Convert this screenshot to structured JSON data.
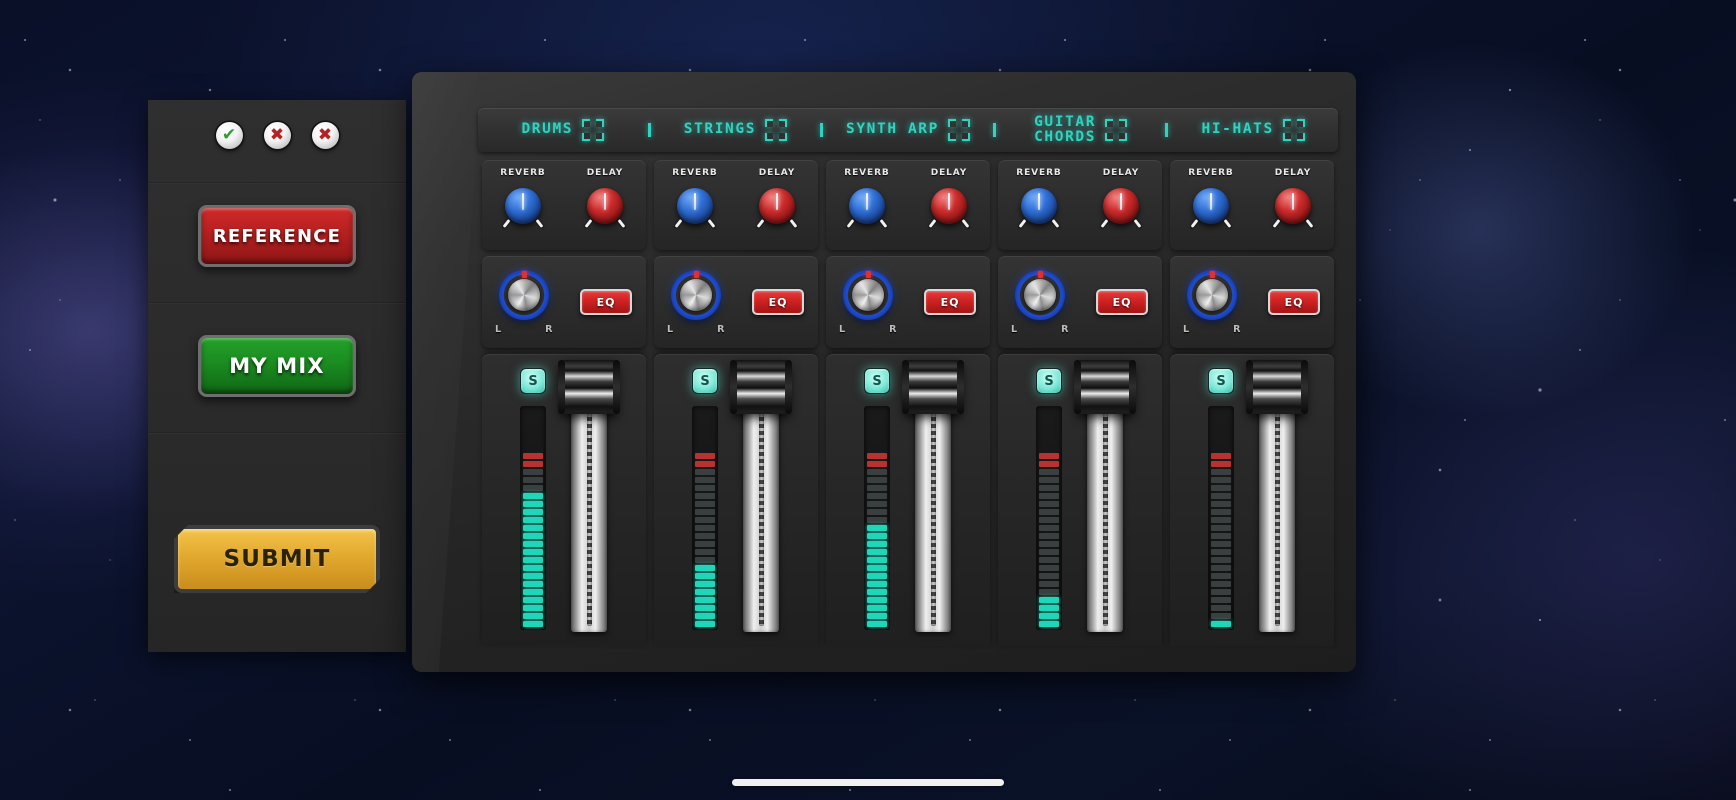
{
  "background": {
    "name": "starfield-nebula",
    "base_color": "#0a1228"
  },
  "left_panel": {
    "status_indicators": [
      {
        "name": "check-icon",
        "glyph": "✔",
        "state": "ok"
      },
      {
        "name": "cross-icon",
        "glyph": "✖",
        "state": "bad"
      },
      {
        "name": "cross-icon",
        "glyph": "✖",
        "state": "bad"
      }
    ],
    "reference_label": "REFERENCE",
    "mymix_label": "MY MIX",
    "submit_label": "SUBMIT",
    "colors": {
      "reference": "#b31f1f",
      "mymix": "#1a8a20",
      "submit": "#e2a92f"
    }
  },
  "console": {
    "accent_color": "#2fd4c0",
    "separator_glyph": "|",
    "tracks": [
      {
        "name": "DRUMS",
        "reverb_label": "REVERB",
        "delay_label": "DELAY",
        "pan_left_label": "L",
        "pan_right_label": "R",
        "eq_label": "EQ",
        "solo_label": "S",
        "meter_level": 17,
        "meter_total": 22,
        "fader_position": 0
      },
      {
        "name": "STRINGS",
        "reverb_label": "REVERB",
        "delay_label": "DELAY",
        "pan_left_label": "L",
        "pan_right_label": "R",
        "eq_label": "EQ",
        "solo_label": "S",
        "meter_level": 8,
        "meter_total": 22,
        "fader_position": 0
      },
      {
        "name": "SYNTH ARP",
        "reverb_label": "REVERB",
        "delay_label": "DELAY",
        "pan_left_label": "L",
        "pan_right_label": "R",
        "eq_label": "EQ",
        "solo_label": "S",
        "meter_level": 13,
        "meter_total": 22,
        "fader_position": 0
      },
      {
        "name": "GUITAR\nCHORDS",
        "reverb_label": "REVERB",
        "delay_label": "DELAY",
        "pan_left_label": "L",
        "pan_right_label": "R",
        "eq_label": "EQ",
        "solo_label": "S",
        "meter_level": 4,
        "meter_total": 22,
        "fader_position": 0
      },
      {
        "name": "HI-HATS",
        "reverb_label": "REVERB",
        "delay_label": "DELAY",
        "pan_left_label": "L",
        "pan_right_label": "R",
        "eq_label": "EQ",
        "solo_label": "S",
        "meter_level": 1,
        "meter_total": 22,
        "fader_position": 0
      }
    ]
  }
}
